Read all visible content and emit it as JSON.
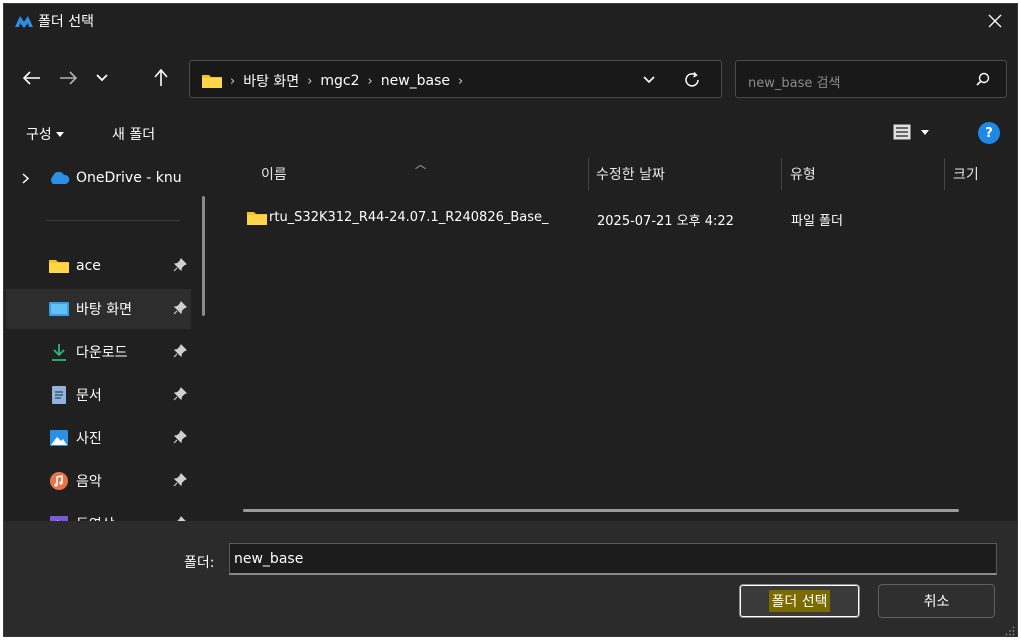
{
  "window": {
    "title": "폴더 선택"
  },
  "nav": {
    "breadcrumbs": [
      "바탕 화면",
      "mgc2",
      "new_base"
    ],
    "search_placeholder": "new_base 검색"
  },
  "toolbar": {
    "organize_label": "구성",
    "new_folder_label": "새 폴더"
  },
  "sidebar": {
    "items": [
      {
        "label": "OneDrive - knu",
        "icon": "onedrive-icon",
        "pinned": false
      },
      {
        "label": "ace",
        "icon": "folder-icon",
        "pinned": true
      },
      {
        "label": "바탕 화면",
        "icon": "desktop-icon",
        "pinned": true,
        "active": true
      },
      {
        "label": "다운로드",
        "icon": "download-icon",
        "pinned": true
      },
      {
        "label": "문서",
        "icon": "document-icon",
        "pinned": true
      },
      {
        "label": "사진",
        "icon": "pictures-icon",
        "pinned": true
      },
      {
        "label": "음악",
        "icon": "music-icon",
        "pinned": true
      },
      {
        "label": "동영상",
        "icon": "video-icon",
        "pinned": true
      }
    ]
  },
  "filelist": {
    "columns": [
      "이름",
      "수정한 날짜",
      "유형",
      "크기"
    ],
    "rows": [
      {
        "name": "rtu_S32K312_R44-24.07.1_R240826_Base_",
        "modified": "2025-07-21 오후 4:22",
        "type": "파일 폴더"
      }
    ]
  },
  "footer": {
    "folder_label": "폴더:",
    "folder_value": "new_base",
    "select_button": "폴더 선택",
    "cancel_button": "취소"
  },
  "colors": {
    "accent": "#1e88e5",
    "folder": "#f5c518",
    "background": "#202020"
  }
}
